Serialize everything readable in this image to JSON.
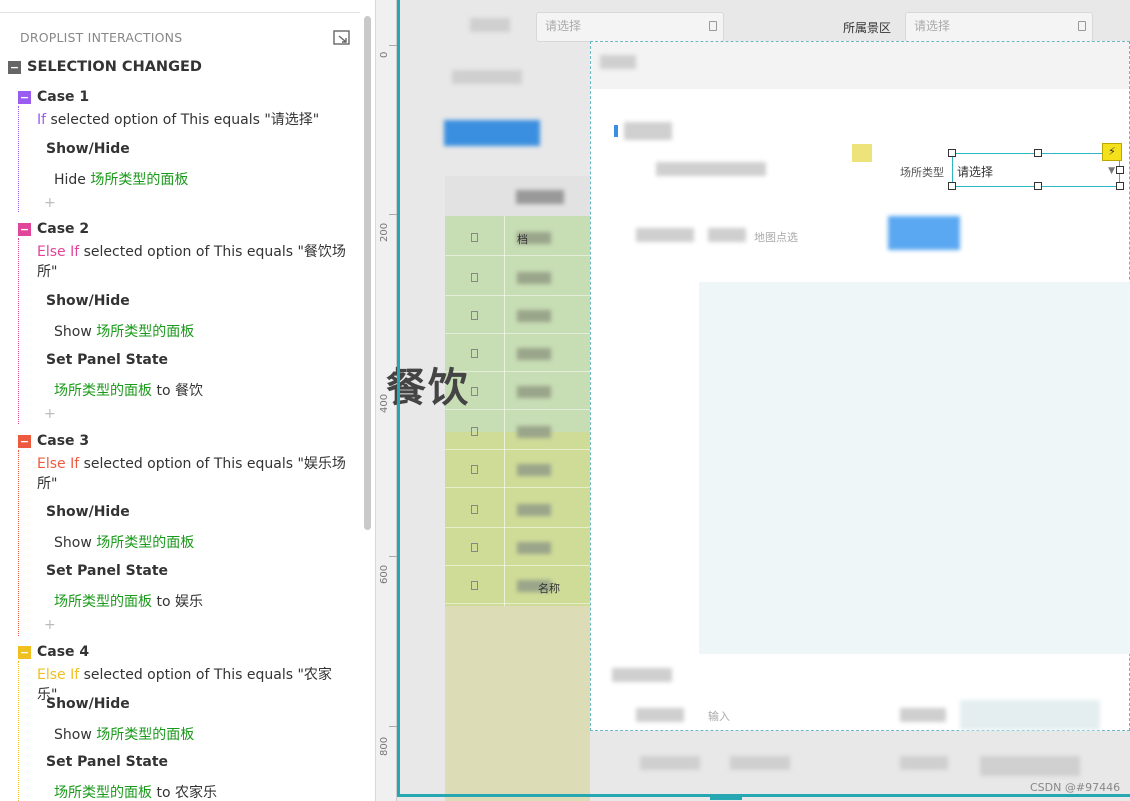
{
  "panel": {
    "header": "DROPLIST INTERACTIONS",
    "event": "SELECTION CHANGED",
    "cases": [
      {
        "label": "Case 1",
        "color": "#9a5cf0",
        "cond_kw": "If",
        "cond_text": " selected option of This equals \"请选择\"",
        "actions": [
          {
            "title": "Show/Hide",
            "verb": "Hide ",
            "target": "场所类型的面板",
            "suffix": ""
          }
        ]
      },
      {
        "label": "Case 2",
        "color": "#e0459a",
        "cond_kw": "Else If",
        "cond_text": " selected option of This equals \"餐饮场所\"",
        "actions": [
          {
            "title": "Show/Hide",
            "verb": "Show ",
            "target": "场所类型的面板",
            "suffix": ""
          },
          {
            "title": "Set Panel State",
            "verb": "",
            "target": "场所类型的面板",
            "suffix": " to 餐饮"
          }
        ]
      },
      {
        "label": "Case 3",
        "color": "#ee5a40",
        "cond_kw": "Else If",
        "cond_text": " selected option of This equals \"娱乐场所\"",
        "actions": [
          {
            "title": "Show/Hide",
            "verb": "Show ",
            "target": "场所类型的面板",
            "suffix": ""
          },
          {
            "title": "Set Panel State",
            "verb": "",
            "target": "场所类型的面板",
            "suffix": " to 娱乐"
          }
        ]
      },
      {
        "label": "Case 4",
        "color": "#f0c020",
        "cond_kw": "Else If",
        "cond_text": " selected option of This equals \"农家乐\"",
        "actions": [
          {
            "title": "Show/Hide",
            "verb": "Show ",
            "target": "场所类型的面板",
            "suffix": ""
          },
          {
            "title": "Set Panel State",
            "verb": "",
            "target": "场所类型的面板",
            "suffix": " to 农家乐"
          }
        ]
      }
    ]
  },
  "ruler": {
    "ticks": [
      "0",
      "200",
      "400",
      "600",
      "800"
    ]
  },
  "canvas": {
    "top_placeholder_1": "请选择",
    "region_label": "所属景区",
    "top_placeholder_2": "请选择",
    "map_pick": "地图点选",
    "table_cell_top": "档",
    "table_cell_bottom": "名称",
    "dialog": {
      "place_type_label": "场所类型",
      "place_type_value": "请选择",
      "panel_state_text": "餐饮"
    },
    "input_hint": "输入"
  },
  "watermark": "CSDN @#97446",
  "icons": {
    "popout": "popout-icon",
    "bolt": "lightning-icon"
  },
  "colors": {
    "frame": "#26a7b2",
    "link_green": "#1a9a1a",
    "event_box": "#666666"
  }
}
